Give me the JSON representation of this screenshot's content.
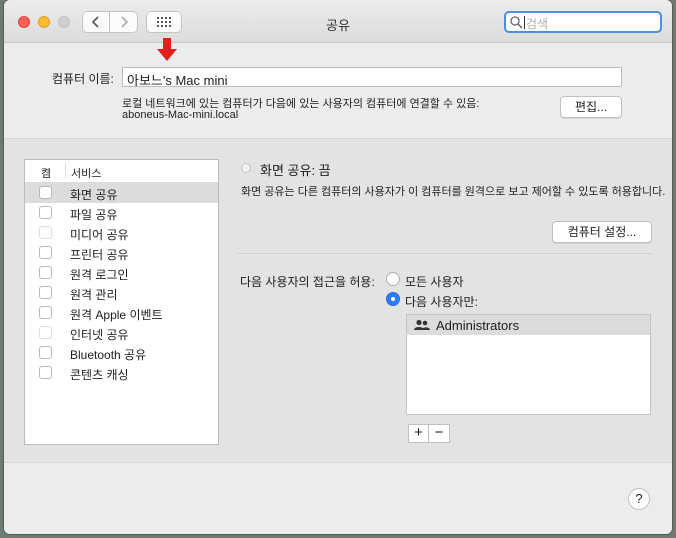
{
  "window": {
    "title": "공유",
    "search_placeholder": "검색"
  },
  "computer": {
    "name_label": "컴퓨터 이름:",
    "name_value": "아보느's Mac mini",
    "network_desc": "로컬 네트워크에 있는 컴퓨터가 다음에 있는 사용자의 컴퓨터에 연결할 수 있음:",
    "hostname": "aboneus-Mac-mini.local",
    "edit_label": "편집..."
  },
  "services": {
    "col_on": "켬",
    "col_service": "서비스",
    "items": [
      {
        "label": "화면 공유",
        "selected": true,
        "enabled": true
      },
      {
        "label": "파일 공유",
        "selected": false,
        "enabled": true
      },
      {
        "label": "미디어 공유",
        "selected": false,
        "enabled": false
      },
      {
        "label": "프린터 공유",
        "selected": false,
        "enabled": true
      },
      {
        "label": "원격 로그인",
        "selected": false,
        "enabled": true
      },
      {
        "label": "원격 관리",
        "selected": false,
        "enabled": true
      },
      {
        "label": "원격 Apple 이벤트",
        "selected": false,
        "enabled": true
      },
      {
        "label": "인터넷 공유",
        "selected": false,
        "enabled": false
      },
      {
        "label": "Bluetooth 공유",
        "selected": false,
        "enabled": true
      },
      {
        "label": "콘텐츠 캐싱",
        "selected": false,
        "enabled": true
      }
    ]
  },
  "detail": {
    "status": "화면 공유: 끔",
    "description": "화면 공유는 다른 컴퓨터의 사용자가 이 컴퓨터를 원격으로 보고 제어할 수 있도록 허용합니다.",
    "computer_settings_label": "컴퓨터 설정...",
    "access_label": "다음 사용자의 접근을 허용:",
    "option_all": "모든 사용자",
    "option_only": "다음 사용자만:",
    "selected_option": "option_only",
    "users": [
      "Administrators"
    ],
    "add_label": "+",
    "remove_label": "−"
  },
  "help_label": "?",
  "colors": {
    "accent": "#2d7cf6",
    "arrow": "#e0201a",
    "close": "#fe5f57",
    "minimize": "#febc2e"
  }
}
